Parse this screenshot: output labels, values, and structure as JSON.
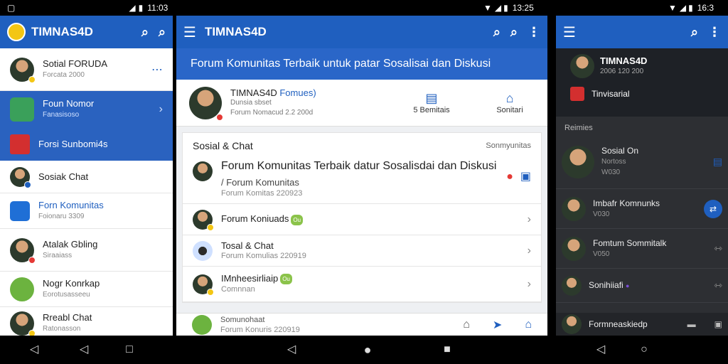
{
  "status": {
    "left_time": "11:03",
    "mid_time": "13:25",
    "right_time": "16:3"
  },
  "app_title": "TIMNAS4D",
  "panel1": {
    "items": [
      {
        "t1": "Sotial FORUDA",
        "t2": "Forcata 2000"
      },
      {
        "t1": "Foun Nomor",
        "t2": "Fanasisoso"
      },
      {
        "t1": "Forsi Sunbomi4s",
        "t2": ""
      },
      {
        "t1": "Sosiak Chat",
        "t2": ""
      },
      {
        "t1": "Forn Komunitas",
        "t2": "Foionaru 3309"
      },
      {
        "t1": "Atalak Gbling",
        "t2": "Siraaiass"
      },
      {
        "t1": "Nogr Konrkap",
        "t2": "Eorotusasseeu"
      },
      {
        "t1": "Rreabl Chat",
        "t2": "Ratonasson"
      }
    ]
  },
  "panel2": {
    "banner": "Forum Komunitas Terbaik untuk patar Sosalisai dan Diskusi",
    "profile": {
      "name": "TIMNAS4D",
      "name_tag": "Fomues)",
      "sub1": "Dunsia sbset",
      "sub2": "Forum Nomacud 2.2 200d",
      "stat1": "5 Bemitais",
      "stat2": "Sonitari"
    },
    "card_title": "Sosial & Chat",
    "card_right": "Sonmyunitas",
    "feature": {
      "title": "Forum Komunitas Terbaik datur Sosalisdai dan Diskusi",
      "l2": "/ Forum Komunitas",
      "l3": "Forum Komitas 220923"
    },
    "rows": [
      {
        "t1": "Forum Koniuads",
        "badge": "Ou",
        "t2": ""
      },
      {
        "t1": "Tosal & Chat",
        "badge": "",
        "t2": "Forum Komulias 220919"
      },
      {
        "t1": "IMnheesirliaip",
        "badge": "Ou",
        "t2": "Comnnan"
      }
    ],
    "bottom": {
      "t1": "Somunohaat",
      "t2": "Forum Konuris 220919"
    }
  },
  "panel3": {
    "profile_name": "TIMNAS4D",
    "profile_sub": "2006 120 200",
    "profile_item": "Tinvisarial",
    "section": "Reimies",
    "items": [
      {
        "t1": "Sosial On",
        "t2": "Nortoss",
        "t3": "W030"
      },
      {
        "t1": "Imbafr Komnunks",
        "t2": "V030",
        "t3": ""
      },
      {
        "t1": "Fomtum Sommitalk",
        "t2": "V050",
        "t3": ""
      },
      {
        "t1": "Sonihiiafi",
        "t2": "",
        "t3": ""
      }
    ],
    "bottom": "Formneaskiedp"
  },
  "colors": {
    "primary": "#1f5fbf",
    "dark_bg": "#2d2f33"
  }
}
